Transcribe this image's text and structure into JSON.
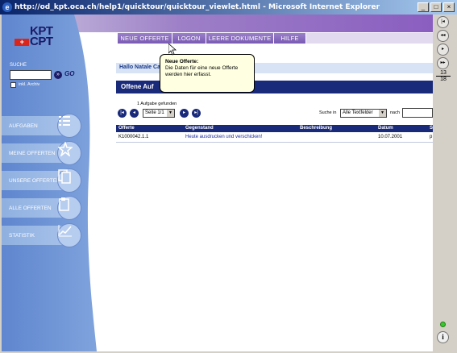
{
  "window": {
    "title": "http://od_kpt.oca.ch/help1/quicktour/quicktour_viewlet.html - Microsoft Internet Explorer",
    "minimize": "_",
    "maximize": "□",
    "close": "×"
  },
  "logo": {
    "line1": "KPT",
    "line2": "CPT",
    "cross": "+"
  },
  "search": {
    "label": "SUCHE",
    "value": "",
    "go_label": "GO",
    "go_arrow": "»",
    "archive_label": "inkl. Archiv"
  },
  "sidebar": {
    "items": [
      {
        "label": "AUFGABEN",
        "icon": "list-icon"
      },
      {
        "label": "MEINE OFFERTEN",
        "icon": "star-icon"
      },
      {
        "label": "UNSERE OFFERTEN",
        "icon": "documents-icon"
      },
      {
        "label": "ALLE OFFERTEN",
        "icon": "folder-icon"
      },
      {
        "label": "STATISTIK",
        "icon": "chart-icon"
      }
    ]
  },
  "menu": {
    "tabs": [
      "NEUE OFFERTE",
      "LOGON",
      "LEERE DOKUMENTE",
      "HILFE"
    ]
  },
  "greeting": "Hallo Natale Ca",
  "section_title": "Offene Auf",
  "list": {
    "found_text": "1 Aufgabe gefunden",
    "page_value": "Seite 1/1",
    "search_in_label": "Suche in",
    "search_in_value": "Alle Textfelder",
    "nach_label": "nach",
    "nach_value": "",
    "pager": {
      "first": "|◂",
      "prev": "◂",
      "next": "▸",
      "last": "▸|"
    },
    "columns": [
      "Offerte",
      "Gegenstand",
      "Beschreibung",
      "Datum",
      "S"
    ],
    "rows": [
      {
        "offerte": "K1000042.1.1",
        "gegenstand": "Heute ausdrucken und verschicken!",
        "beschreibung": "",
        "datum": "10.07.2001",
        "s": "p"
      }
    ]
  },
  "tooltip": {
    "title": "Neue Offerte:",
    "text": "Die Daten für eine neue Offerte werden hier erfasst."
  },
  "player": {
    "first": "|◂",
    "back": "◂◂",
    "play": "▸",
    "forward": "▸▸",
    "current": "13",
    "total": "18",
    "info": "i"
  }
}
